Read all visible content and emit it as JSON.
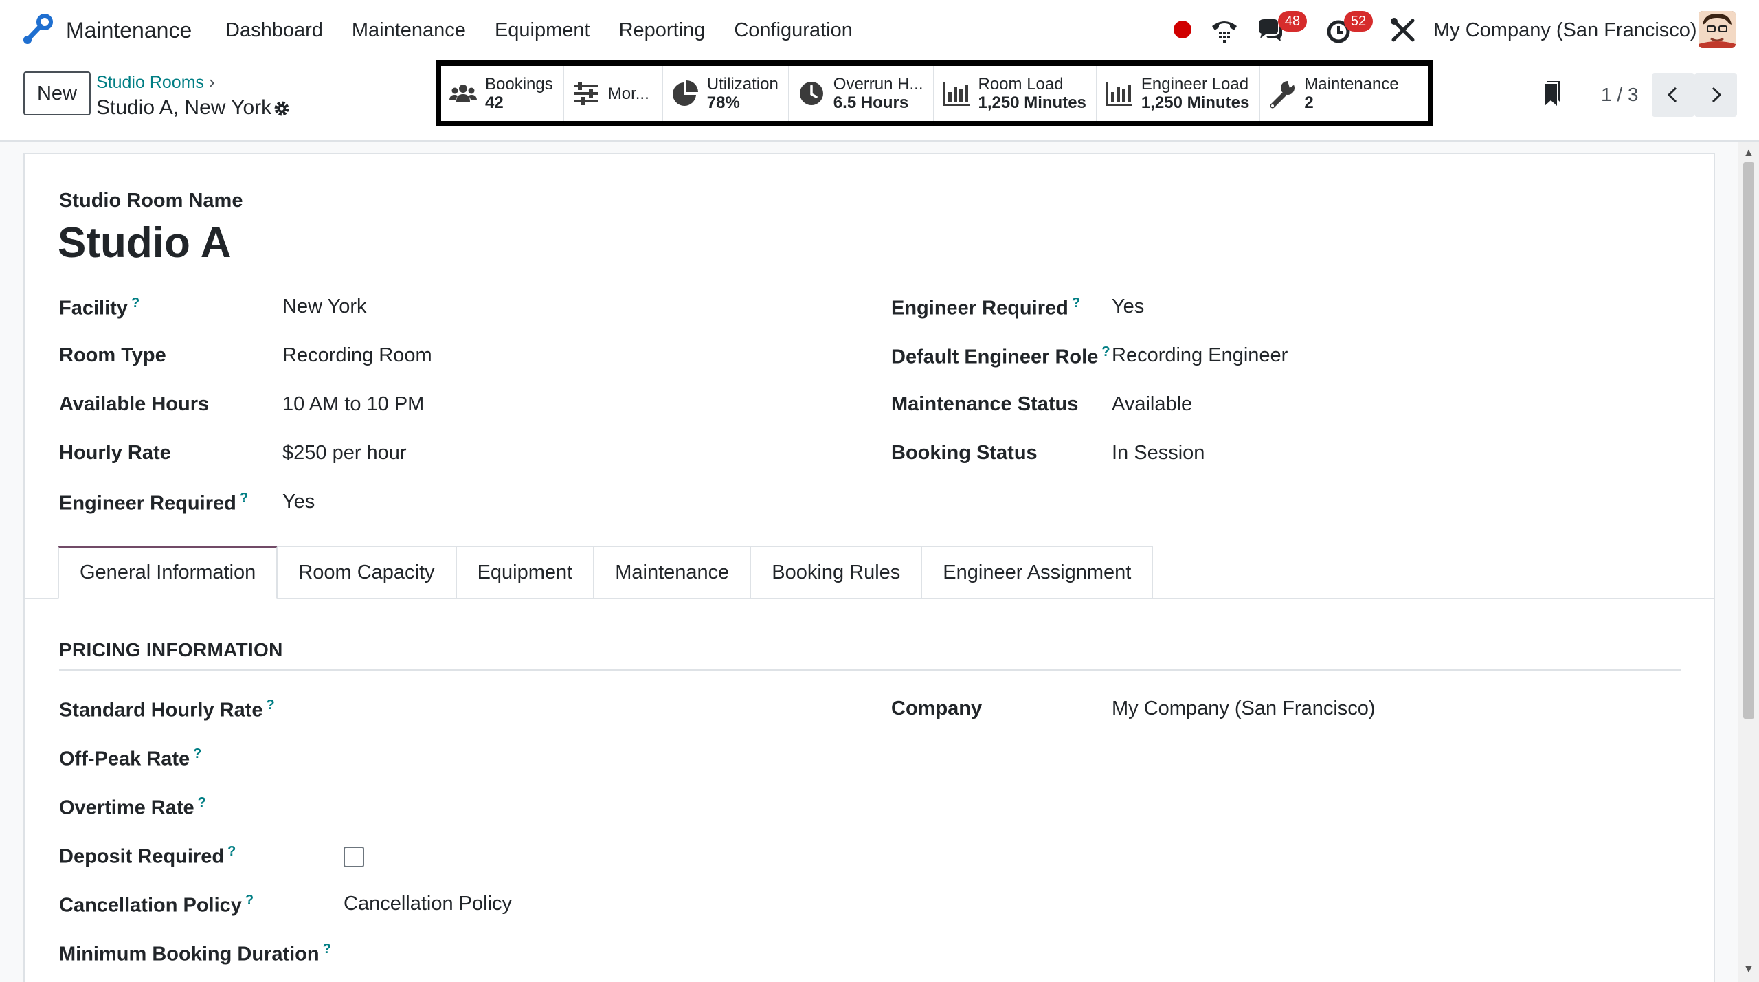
{
  "navbar": {
    "app_name": "Maintenance",
    "menu": [
      "Dashboard",
      "Maintenance",
      "Equipment",
      "Reporting",
      "Configuration"
    ],
    "messages_count": "48",
    "activities_count": "52",
    "company": "My Company (San Francisco)"
  },
  "control_panel": {
    "new_label": "New",
    "breadcrumb_parent": "Studio Rooms",
    "record_name": "Studio A, New York",
    "pager": "1 / 3"
  },
  "smart_buttons": [
    {
      "label": "Bookings",
      "value": "42",
      "icon": "users-icon"
    },
    {
      "label": "Mor...",
      "value": "",
      "icon": "sliders-icon"
    },
    {
      "label": "Utilization",
      "value": "78%",
      "icon": "pie-chart-icon"
    },
    {
      "label": "Overrun H...",
      "value": "6.5 Hours",
      "icon": "clock-icon"
    },
    {
      "label": "Room Load",
      "value": "1,250 Minutes",
      "icon": "bar-chart-icon"
    },
    {
      "label": "Engineer Load",
      "value": "1,250 Minutes",
      "icon": "bar-chart-icon"
    },
    {
      "label": "Maintenance",
      "value": "2",
      "icon": "wrench-icon"
    }
  ],
  "form": {
    "title_label": "Studio Room Name",
    "title": "Studio A",
    "left_fields": [
      {
        "label": "Facility",
        "help": "?",
        "value": "New York"
      },
      {
        "label": "Room Type",
        "help": "",
        "value": "Recording Room"
      },
      {
        "label": "Available Hours",
        "help": "",
        "value": "10 AM to 10 PM"
      },
      {
        "label": "Hourly Rate",
        "help": "",
        "value": "$250 per hour"
      },
      {
        "label": "Engineer Required",
        "help": "?",
        "value": "Yes"
      }
    ],
    "right_fields": [
      {
        "label": "Engineer Required",
        "help": "?",
        "value": "Yes"
      },
      {
        "label": "Default Engineer Role",
        "help": "?",
        "value": "Recording Engineer"
      },
      {
        "label": "Maintenance Status",
        "help": "",
        "value": "Available"
      },
      {
        "label": "Booking Status",
        "help": "",
        "value": "In Session"
      }
    ],
    "tabs": [
      "General Information",
      "Room Capacity",
      "Equipment",
      "Maintenance",
      "Booking Rules",
      "Engineer Assignment"
    ],
    "active_tab": "General Information",
    "section_title": "PRICING INFORMATION",
    "pricing_fields": [
      {
        "label": "Standard Hourly Rate",
        "help": "?",
        "value": ""
      },
      {
        "label": "Off-Peak Rate",
        "help": "?",
        "value": ""
      },
      {
        "label": "Overtime Rate",
        "help": "?",
        "value": ""
      },
      {
        "label": "Deposit Required",
        "help": "?",
        "value": "",
        "checkbox": true,
        "checked": false
      },
      {
        "label": "Cancellation Policy",
        "help": "?",
        "value": "Cancellation Policy"
      },
      {
        "label": "Minimum Booking Duration",
        "help": "?",
        "value": ""
      }
    ],
    "company_label": "Company",
    "company_value": "My Company (San Francisco)"
  },
  "colors": {
    "accent": "#017e84",
    "brand": "#714b67",
    "badge": "#d62c2c"
  }
}
